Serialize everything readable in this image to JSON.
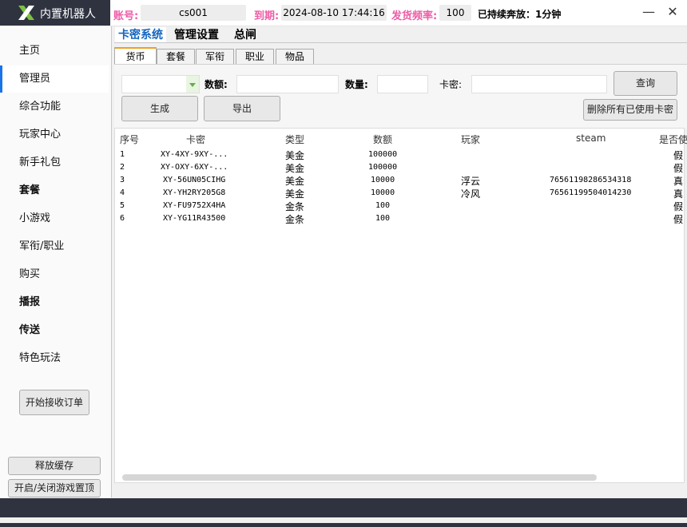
{
  "app": {
    "title": "内置机器人"
  },
  "header": {
    "account_label": "账号:",
    "account_value": "cs001",
    "expire_label": "到期:",
    "expire_value": "2024-08-10 17:44:16",
    "rate_label": "发货频率:",
    "rate_value": "100",
    "runtime_text": "已持续奔放：1分钟",
    "minimize": "—",
    "close": "✕"
  },
  "sidebar": {
    "items": [
      {
        "label": "主页"
      },
      {
        "label": "管理员"
      },
      {
        "label": "综合功能"
      },
      {
        "label": "玩家中心"
      },
      {
        "label": "新手礼包"
      },
      {
        "label": "套餐"
      },
      {
        "label": "小游戏"
      },
      {
        "label": "军衔/职业"
      },
      {
        "label": "购买"
      },
      {
        "label": "播报"
      },
      {
        "label": "传送"
      },
      {
        "label": "特色玩法"
      }
    ],
    "start_orders": "开始接收订单",
    "release_cache": "释放缓存",
    "toggle_top": "开启/关闭游戏置顶"
  },
  "main_tabs": [
    "卡密系统",
    "管理设置",
    "总闸"
  ],
  "inner_tabs": [
    "货币",
    "套餐",
    "军衔",
    "职业",
    "物品"
  ],
  "form": {
    "amount_label": "数额:",
    "qty_label": "数量:",
    "card_label": "卡密:",
    "query": "查询",
    "generate": "生成",
    "export": "导出",
    "delete_used": "删除所有已使用卡密"
  },
  "table": {
    "headers": [
      "序号",
      "卡密",
      "类型",
      "数额",
      "玩家",
      "steam",
      "是否使"
    ],
    "rows": [
      {
        "no": "1",
        "card": "XY-4XY-9XY-...",
        "type": "美金",
        "amount": "100000",
        "player": "",
        "steam": "",
        "used": "假"
      },
      {
        "no": "2",
        "card": "XY-OXY-6XY-...",
        "type": "美金",
        "amount": "100000",
        "player": "",
        "steam": "",
        "used": "假"
      },
      {
        "no": "3",
        "card": "XY-56UN05CIHG",
        "type": "美金",
        "amount": "10000",
        "player": "浮云",
        "steam": "76561198286534318",
        "used": "真"
      },
      {
        "no": "4",
        "card": "XY-YH2RY205G8",
        "type": "美金",
        "amount": "10000",
        "player": "冷风",
        "steam": "76561199504014230",
        "used": "真"
      },
      {
        "no": "5",
        "card": "XY-FU9752X4HA",
        "type": "金条",
        "amount": "100",
        "player": "",
        "steam": "",
        "used": "假"
      },
      {
        "no": "6",
        "card": "XY-YG11R43500",
        "type": "金条",
        "amount": "100",
        "player": "",
        "steam": "",
        "used": "假"
      }
    ]
  },
  "colors": {
    "dark": "#2f3340",
    "label_pink": "#ee5ca7",
    "active_blue": "#1565c0",
    "tab_orange": "#f0a020"
  }
}
